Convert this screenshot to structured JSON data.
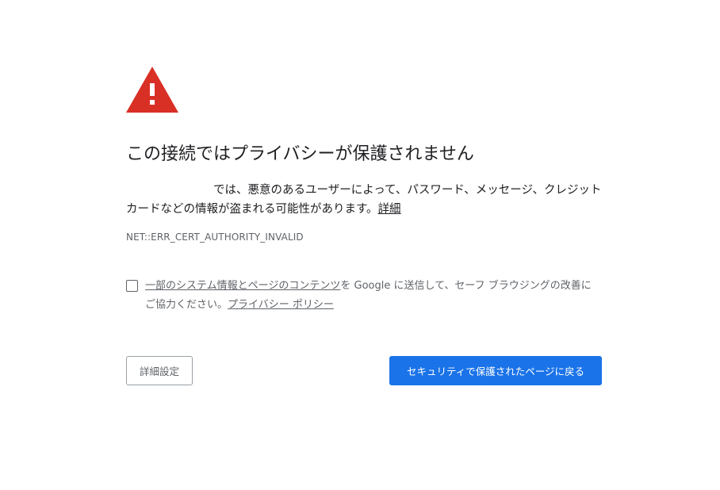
{
  "interstitial": {
    "icon": "warning-triangle-icon",
    "icon_color": "#d93025",
    "title": "この接続ではプライバシーが保護されません",
    "description_text": "では、悪意のあるユーザーによって、パスワード、メッセージ、クレジット カードなどの情報が盗まれる可能性があります。",
    "details_link": "詳細",
    "error_code": "NET::ERR_CERT_AUTHORITY_INVALID"
  },
  "safe_browsing_optin": {
    "checked": false,
    "link_text": "一部のシステム情報とページのコンテンツ",
    "text": "を Google に送信して、セーフ ブラウジングの改善にご協力ください。",
    "privacy_link": "プライバシー ポリシー"
  },
  "buttons": {
    "advanced_label": "詳細設定",
    "back_to_safety_label": "セキュリティで保護されたページに戻る",
    "primary_color": "#1a73e8"
  }
}
